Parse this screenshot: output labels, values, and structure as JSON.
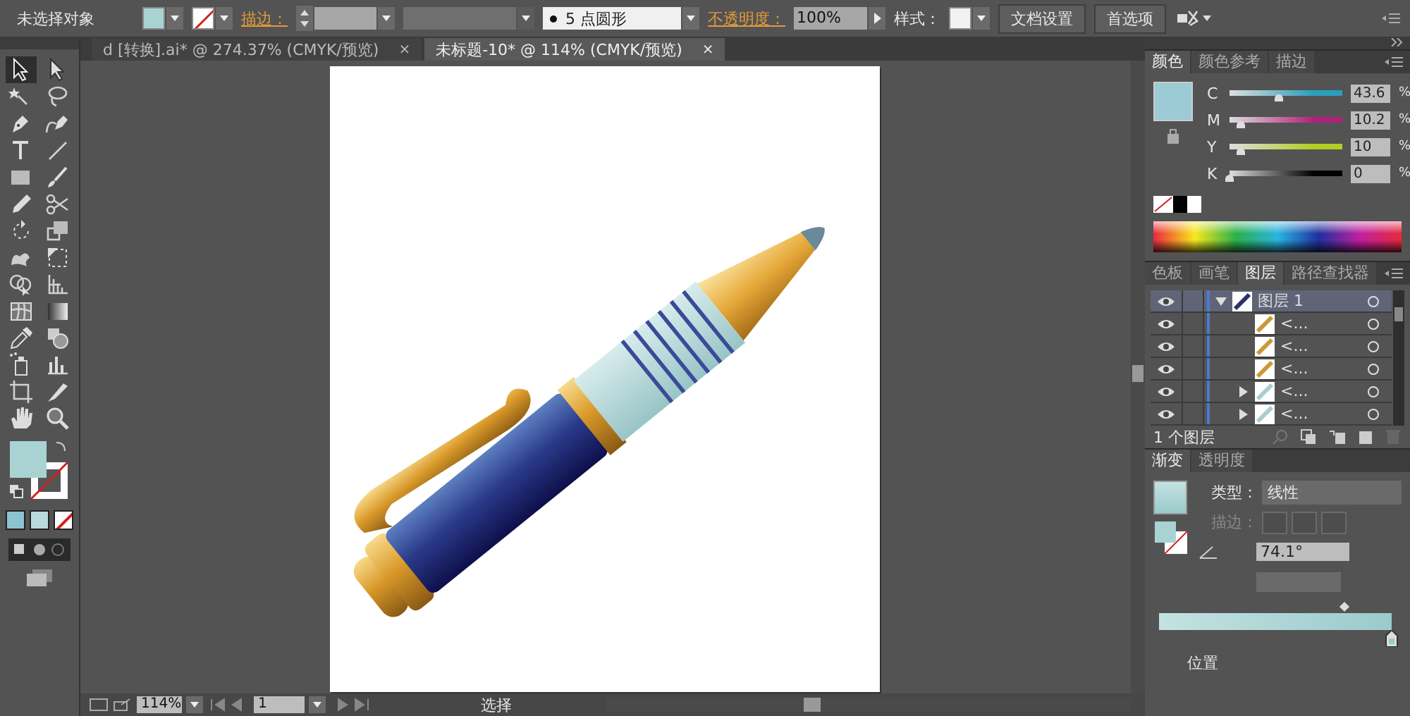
{
  "control_bar": {
    "selection": "未选择对象",
    "stroke_label": "描边：",
    "brush": "5 点圆形",
    "opacity_label": "不透明度：",
    "opacity": "100%",
    "style_label": "样式：",
    "buttons": [
      "文档设置",
      "首选项"
    ]
  },
  "document_tabs": [
    {
      "label": "d [转换].ai* @ 274.37% (CMYK/预览)",
      "close": "×",
      "selected": false
    },
    {
      "label": "未标题-10* @ 114% (CMYK/预览)",
      "close": "×",
      "selected": true
    }
  ],
  "color_panel": {
    "tabs": [
      {
        "label": "颜色",
        "selected": true
      },
      {
        "label": "颜色参考",
        "selected": false
      },
      {
        "label": "描边",
        "selected": false
      }
    ],
    "channels": [
      {
        "name": "C",
        "color": "#2a9fbb",
        "level": 0.436,
        "value": "43.6",
        "unit": "%"
      },
      {
        "name": "M",
        "color": "#b0207a",
        "level": 0.1025,
        "value": "10.2",
        "unit": "%"
      },
      {
        "name": "Y",
        "color": "#b4cc22",
        "level": 0.1,
        "value": "10",
        "unit": "%"
      },
      {
        "name": "K",
        "color": "#000000",
        "level": 0,
        "value": "0",
        "unit": "%"
      }
    ]
  },
  "layers_panel": {
    "tabs": [
      {
        "label": "色板",
        "selected": false
      },
      {
        "label": "画笔",
        "selected": false
      },
      {
        "label": "图层",
        "selected": true
      },
      {
        "label": "路径查找器",
        "selected": false
      }
    ],
    "layers": [
      {
        "name": "图层 1",
        "kind": "layer",
        "expanded": true,
        "selected": true,
        "children": [
          {
            "name": "<...",
            "kind": "path",
            "selected": false
          },
          {
            "name": "<...",
            "kind": "path",
            "selected": false
          },
          {
            "name": "<...",
            "kind": "path",
            "selected": false
          },
          {
            "name": "<...",
            "kind": "group",
            "expanded": false,
            "selected": false
          },
          {
            "name": "<...",
            "kind": "group",
            "expanded": false,
            "selected": false
          }
        ]
      }
    ],
    "footer": "1 个图层"
  },
  "gradient_panel": {
    "tabs": [
      {
        "label": "渐变",
        "selected": true
      },
      {
        "label": "透明度",
        "selected": false
      }
    ],
    "type_label": "类型：",
    "type": "线性",
    "stroke_label": "描边：",
    "angle": "74.1°",
    "slider": {
      "level": 0.8
    },
    "position_label": "位置"
  },
  "status_bar": {
    "zoom": "114%",
    "artboard": "1",
    "tool": "选择"
  }
}
